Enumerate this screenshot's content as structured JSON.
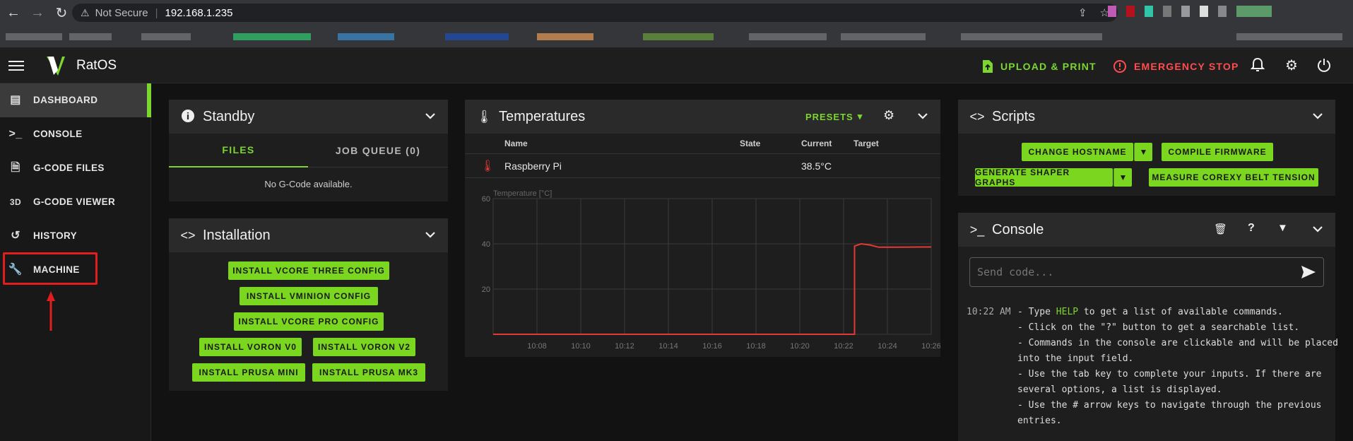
{
  "browser": {
    "security_label": "Not Secure",
    "url": "192.168.1.235"
  },
  "app": {
    "title": "RatOS",
    "upload_label": "UPLOAD & PRINT",
    "emergency_label": "EMERGENCY STOP"
  },
  "sidebar": {
    "items": [
      {
        "label": "DASHBOARD",
        "icon": "dashboard-icon"
      },
      {
        "label": "CONSOLE",
        "icon": "console-icon"
      },
      {
        "label": "G-CODE FILES",
        "icon": "file-icon"
      },
      {
        "label": "G-CODE VIEWER",
        "icon": "3d-icon"
      },
      {
        "label": "HISTORY",
        "icon": "history-icon"
      },
      {
        "label": "MACHINE",
        "icon": "wrench-icon"
      }
    ]
  },
  "standby": {
    "title": "Standby",
    "tab_files": "FILES",
    "tab_queue": "JOB QUEUE (0)",
    "empty_text": "No G-Code available."
  },
  "installation": {
    "title": "Installation",
    "buttons": [
      "INSTALL VCORE THREE CONFIG",
      "INSTALL VMINION CONFIG",
      "INSTALL VCORE PRO CONFIG",
      "INSTALL VORON V0",
      "INSTALL VORON V2",
      "INSTALL PRUSA MINI",
      "INSTALL PRUSA MK3"
    ]
  },
  "temperatures": {
    "title": "Temperatures",
    "presets_label": "PRESETS",
    "columns": [
      "Name",
      "State",
      "Current",
      "Target"
    ],
    "rows": [
      {
        "name": "Raspberry Pi",
        "state": "",
        "current": "38.5°C",
        "target": ""
      }
    ]
  },
  "chart_data": {
    "type": "line",
    "ylabel": "Temperature [°C]",
    "ylim": [
      0,
      60
    ],
    "y_ticks": [
      "60",
      "40",
      "20"
    ],
    "x_ticks": [
      "10:08",
      "10:10",
      "10:12",
      "10:14",
      "10:16",
      "10:18",
      "10:20",
      "10:22",
      "10:24",
      "10:26"
    ],
    "series": [
      {
        "color": "#e53935",
        "x": [
          "10:06",
          "10:22.5",
          "10:22.5",
          "10:22.8",
          "10:23.2",
          "10:23.6",
          "10:24.5",
          "10:25.5",
          "10:26"
        ],
        "values": [
          0,
          0,
          39,
          40,
          39.5,
          38.5,
          38.5,
          38.6,
          38.6
        ]
      }
    ]
  },
  "scripts": {
    "title": "Scripts",
    "buttons": [
      "CHANGE HOSTNAME",
      "COMPILE FIRMWARE",
      "GENERATE SHAPER GRAPHS",
      "MEASURE COREXY BELT TENSION"
    ]
  },
  "console": {
    "title": "Console",
    "placeholder": "Send code...",
    "time": "10:22 AM",
    "lines": [
      "- Type HELP to get a list of available commands.",
      "- Click on the \"?\" button to get a searchable list.",
      "- Commands in the console are clickable and will be placed",
      "into the input field.",
      "- Use the tab key to complete your inputs. If there are",
      "several options, a list is displayed.",
      "- Use the # arrow keys to navigate through the previous",
      "entries."
    ]
  }
}
